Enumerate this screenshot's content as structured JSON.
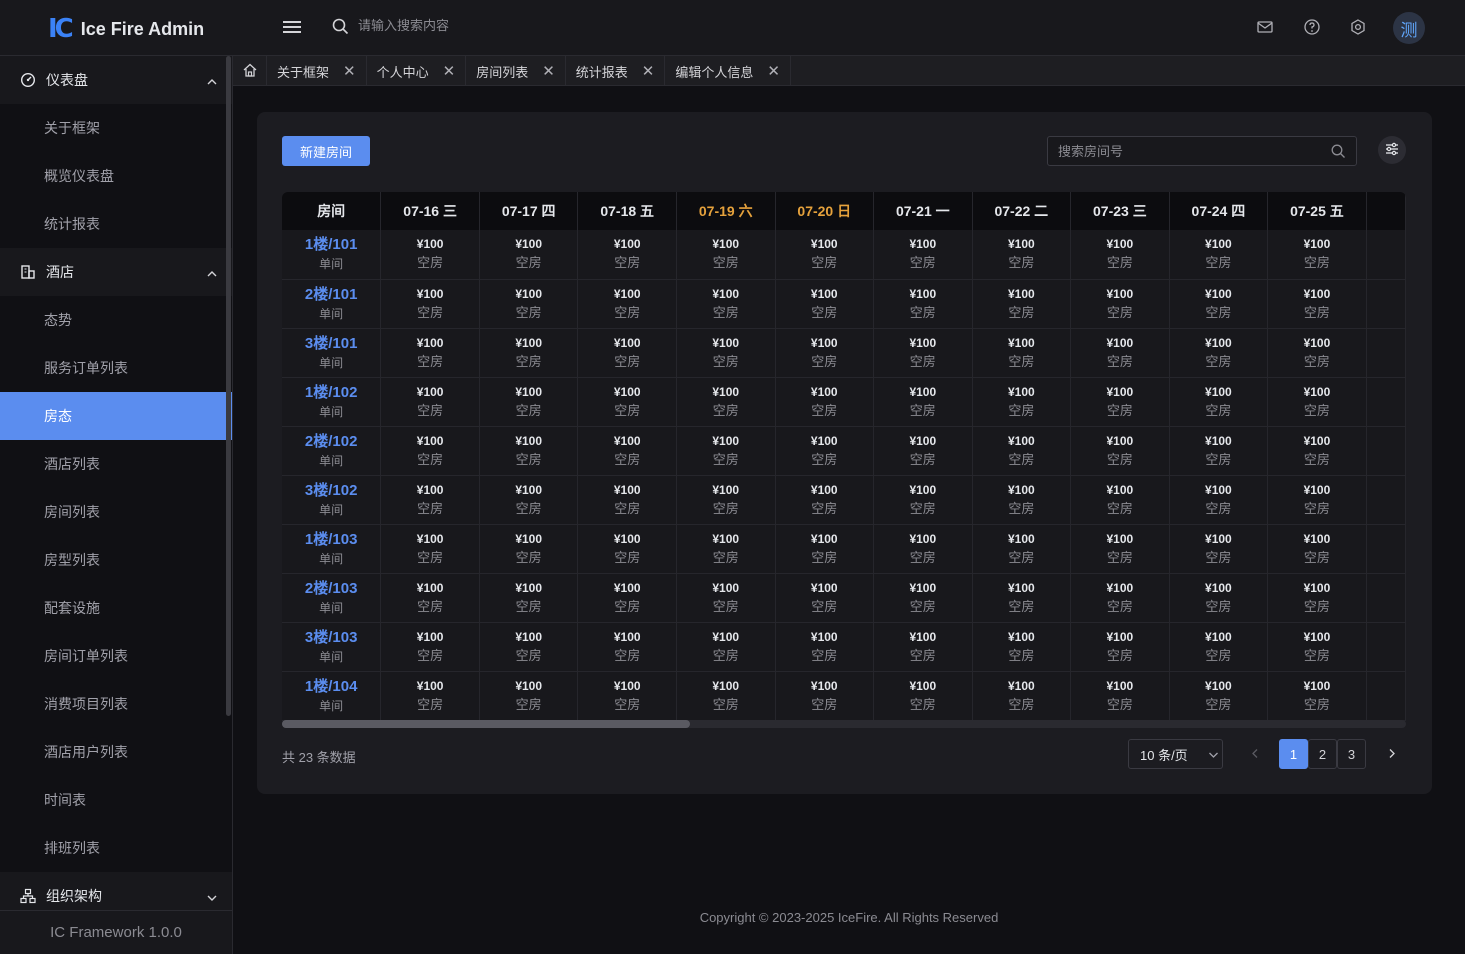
{
  "header": {
    "logo_mark": "IC",
    "app_title": "Ice Fire Admin",
    "search_placeholder": "请输入搜索内容",
    "avatar_text": "测"
  },
  "sidebar": {
    "group_dashboard": "仪表盘",
    "dashboard_items": [
      "关于框架",
      "概览仪表盘",
      "统计报表"
    ],
    "group_hotel": "酒店",
    "hotel_items": [
      "态势",
      "服务订单列表",
      "房态",
      "酒店列表",
      "房间列表",
      "房型列表",
      "配套设施",
      "房间订单列表",
      "消费项目列表",
      "酒店用户列表",
      "时间表",
      "排班列表"
    ],
    "active_item": "房态",
    "group_org": "组织架构",
    "footer": "IC Framework 1.0.0"
  },
  "tabs": [
    "关于框架",
    "个人中心",
    "房间列表",
    "统计报表",
    "编辑个人信息"
  ],
  "toolbar": {
    "new_room": "新建房间",
    "room_search_placeholder": "搜索房间号"
  },
  "table": {
    "room_header": "房间",
    "dates": [
      {
        "label": "07-16 三",
        "weekend": false
      },
      {
        "label": "07-17 四",
        "weekend": false
      },
      {
        "label": "07-18 五",
        "weekend": false
      },
      {
        "label": "07-19 六",
        "weekend": true
      },
      {
        "label": "07-20 日",
        "weekend": true
      },
      {
        "label": "07-21 一",
        "weekend": false
      },
      {
        "label": "07-22 二",
        "weekend": false
      },
      {
        "label": "07-23 三",
        "weekend": false
      },
      {
        "label": "07-24 四",
        "weekend": false
      },
      {
        "label": "07-25 五",
        "weekend": false
      }
    ],
    "rows": [
      {
        "room": "1楼/101",
        "type": "单间"
      },
      {
        "room": "2楼/101",
        "type": "单间"
      },
      {
        "room": "3楼/101",
        "type": "单间"
      },
      {
        "room": "1楼/102",
        "type": "单间"
      },
      {
        "room": "2楼/102",
        "type": "单间"
      },
      {
        "room": "3楼/102",
        "type": "单间"
      },
      {
        "room": "1楼/103",
        "type": "单间"
      },
      {
        "room": "2楼/103",
        "type": "单间"
      },
      {
        "room": "3楼/103",
        "type": "单间"
      },
      {
        "room": "1楼/104",
        "type": "单间"
      }
    ],
    "cell_price": "¥100",
    "cell_status": "空房"
  },
  "pagination": {
    "total_text": "共 23 条数据",
    "page_size": "10 条/页",
    "pages": [
      "1",
      "2",
      "3"
    ],
    "current": "1"
  },
  "footer": {
    "copyright": "Copyright © 2023-2025 IceFire. All Rights Reserved"
  },
  "colors": {
    "accent": "#5b8def",
    "weekend": "#e6a23c",
    "background": "#101014"
  }
}
